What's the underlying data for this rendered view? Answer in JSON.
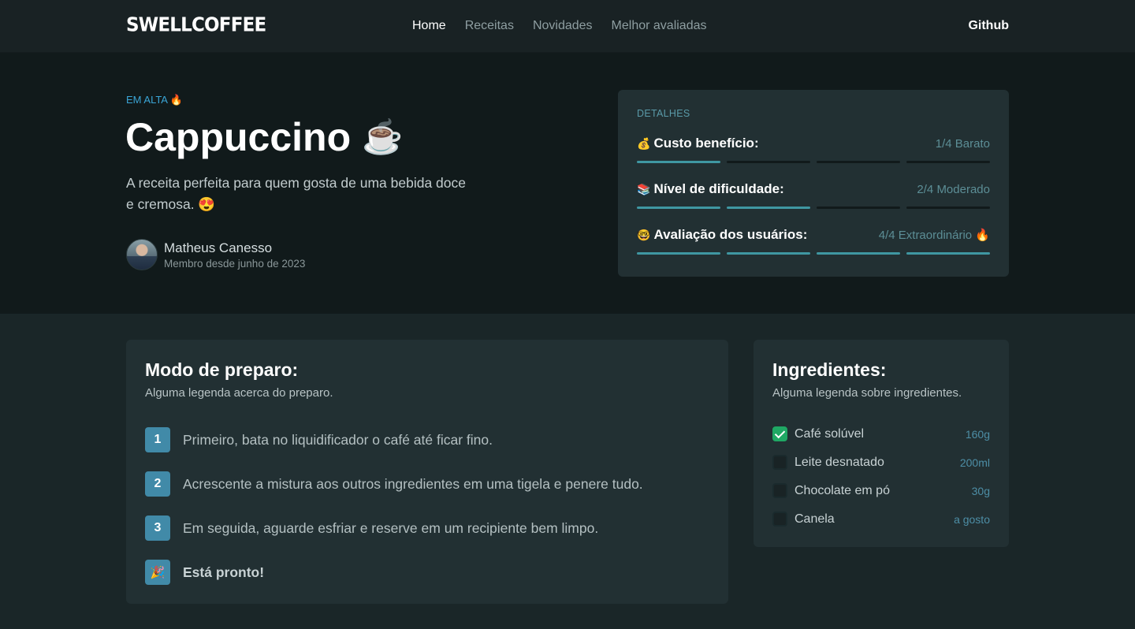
{
  "header": {
    "logo": "SWELLCOFFEE",
    "nav": [
      {
        "label": "Home"
      },
      {
        "label": "Receitas"
      },
      {
        "label": "Novidades"
      },
      {
        "label": "Melhor avaliadas"
      }
    ],
    "github_label": "Github"
  },
  "hero": {
    "kicker": "EM ALTA 🔥",
    "title": "Cappuccino",
    "title_emoji": "☕",
    "subtitle": "A receita perfeita para quem gosta de uma bebida doce e cremosa. 😍",
    "author": {
      "name": "Matheus Canesso",
      "since": "Membro desde junho de 2023"
    }
  },
  "details": {
    "label": "DETALHES",
    "rows": [
      {
        "emoji": "💰",
        "name": "Custo benefício:",
        "value": "1/4 Barato",
        "level": 1,
        "max": 4
      },
      {
        "emoji": "📚",
        "name": "Nível de dificuldade:",
        "value": "2/4 Moderado",
        "level": 2,
        "max": 4
      },
      {
        "emoji": "🤓",
        "name": "Avaliação dos usuários:",
        "value": "4/4 Extraordinário 🔥",
        "level": 4,
        "max": 4
      }
    ]
  },
  "prep": {
    "title": "Modo de preparo:",
    "subtitle": "Alguma legenda acerca do preparo.",
    "steps": [
      {
        "badge": "1",
        "text": "Primeiro, bata no liquidificador o café até ficar fino."
      },
      {
        "badge": "2",
        "text": "Acrescente a mistura aos outros ingredientes em uma tigela e penere tudo."
      },
      {
        "badge": "3",
        "text": "Em seguida, aguarde esfriar e reserve em um recipiente bem limpo."
      },
      {
        "badge": "🎉",
        "text": "Está pronto!"
      }
    ]
  },
  "ingredients": {
    "title": "Ingredientes:",
    "subtitle": "Alguma legenda sobre ingredientes.",
    "items": [
      {
        "name": "Café solúvel",
        "qty": "160g",
        "checked": true
      },
      {
        "name": "Leite desnatado",
        "qty": "200ml",
        "checked": false
      },
      {
        "name": "Chocolate em pó",
        "qty": "30g",
        "checked": false
      },
      {
        "name": "Canela",
        "qty": "a gosto",
        "checked": false
      }
    ]
  },
  "colors": {
    "accent": "#3f97a2",
    "check": "#1fa864",
    "step_badge": "#418aa8"
  }
}
